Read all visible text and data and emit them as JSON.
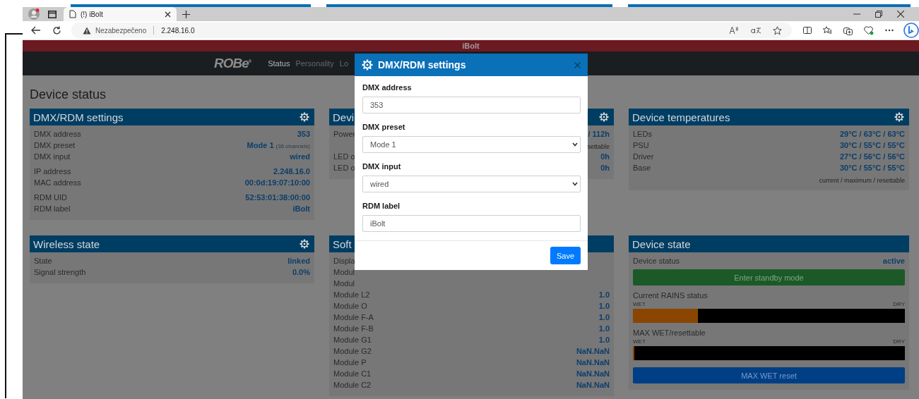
{
  "browser": {
    "tab_title": "(!) iBolt",
    "security_label": "Nezabezpečeno",
    "url": "2.248.16.0"
  },
  "site": {
    "banner": "iBolt",
    "logo": "ROBe",
    "logo_mark": "®",
    "nav": [
      {
        "label": "Status",
        "selected": true
      },
      {
        "label": "Personality",
        "selected": false
      },
      {
        "label": "Lo",
        "selected": false
      }
    ]
  },
  "page_title": "Device status",
  "panels": [
    {
      "title": "DMX/RDM settings",
      "has_settings": true,
      "rows": [
        {
          "kind": "row",
          "label": "DMX address",
          "value": "353"
        },
        {
          "kind": "row",
          "label": "DMX preset",
          "value": "Mode 1",
          "value_note": "(36 channels)"
        },
        {
          "kind": "row",
          "label": "DMX input",
          "value": "wired"
        },
        {
          "kind": "spacer"
        },
        {
          "kind": "row",
          "label": "IP address",
          "value": "2.248.16.0"
        },
        {
          "kind": "row",
          "label": "MAC address",
          "value": "00:0d:19:07:10:00"
        },
        {
          "kind": "spacer"
        },
        {
          "kind": "row",
          "label": "RDM UID",
          "value": "52:53:01:38:00:00"
        },
        {
          "kind": "row",
          "label": "RDM label",
          "value": "iBolt"
        }
      ]
    },
    {
      "title": "Devi",
      "has_settings": true,
      "rows": [
        {
          "kind": "row",
          "label": "Power",
          "value": "/ 112h"
        },
        {
          "kind": "note",
          "text": "settable"
        },
        {
          "kind": "row",
          "label": "LED o",
          "value": "0h"
        },
        {
          "kind": "row",
          "label": "LED o",
          "value": "0h"
        }
      ]
    },
    {
      "title": "Device temperatures",
      "has_settings": true,
      "rows": [
        {
          "kind": "row",
          "label": "LEDs",
          "value": "29°C / 63°C / 63°C"
        },
        {
          "kind": "row",
          "label": "PSU",
          "value": "30°C / 55°C / 55°C"
        },
        {
          "kind": "row",
          "label": "Driver",
          "value": "27°C / 56°C / 56°C"
        },
        {
          "kind": "row",
          "label": "Base",
          "value": "30°C / 55°C / 55°C"
        },
        {
          "kind": "note",
          "text": "current / maximum / resettable"
        }
      ]
    },
    {
      "title": "Wireless state",
      "has_settings": true,
      "rows": [
        {
          "kind": "row",
          "label": "State",
          "value": "linked"
        },
        {
          "kind": "row",
          "label": "Signal strength",
          "value": "0.0%"
        }
      ]
    },
    {
      "title": "Soft",
      "has_settings": false,
      "rows": [
        {
          "kind": "row",
          "label": "Displa"
        },
        {
          "kind": "row",
          "label": "Modul"
        },
        {
          "kind": "row",
          "label": "Modul"
        },
        {
          "kind": "row",
          "label": "Module L2",
          "value": "1.0"
        },
        {
          "kind": "row",
          "label": "Module O",
          "value": "1.0"
        },
        {
          "kind": "row",
          "label": "Module F-A",
          "value": "1.0"
        },
        {
          "kind": "row",
          "label": "Module F-B",
          "value": "1.0"
        },
        {
          "kind": "row",
          "label": "Module G1",
          "value": "1.0"
        },
        {
          "kind": "row",
          "label": "Module G2",
          "value": "NaN.NaN"
        },
        {
          "kind": "row",
          "label": "Module P",
          "value": "NaN.NaN"
        },
        {
          "kind": "row",
          "label": "Module C1",
          "value": "NaN.NaN"
        },
        {
          "kind": "row",
          "label": "Module C2",
          "value": "NaN.NaN"
        }
      ]
    },
    {
      "title": "Device state",
      "has_settings": false,
      "rows": [
        {
          "kind": "row",
          "label": "Device status",
          "value": "active"
        },
        {
          "kind": "button",
          "label": "Enter standby mode"
        },
        {
          "kind": "spacer"
        },
        {
          "kind": "meter",
          "label": "Current RAINS status",
          "start": "WET",
          "end": "DRY",
          "level": 0.24
        },
        {
          "kind": "meter",
          "label": "MAX WET/resettable",
          "start": "WET",
          "end": "DRY",
          "level": 0.006
        },
        {
          "kind": "button",
          "label": "MAX WET reset"
        }
      ]
    }
  ],
  "modal": {
    "title": "DMX/RDM settings",
    "fields": [
      {
        "kind": "input",
        "label": "DMX address",
        "value": "353"
      },
      {
        "kind": "select",
        "label": "DMX preset",
        "value": "Mode 1"
      },
      {
        "kind": "select",
        "label": "DMX input",
        "value": "wired"
      },
      {
        "kind": "input",
        "label": "RDM label",
        "value": "iBolt"
      }
    ],
    "save": "Save"
  }
}
